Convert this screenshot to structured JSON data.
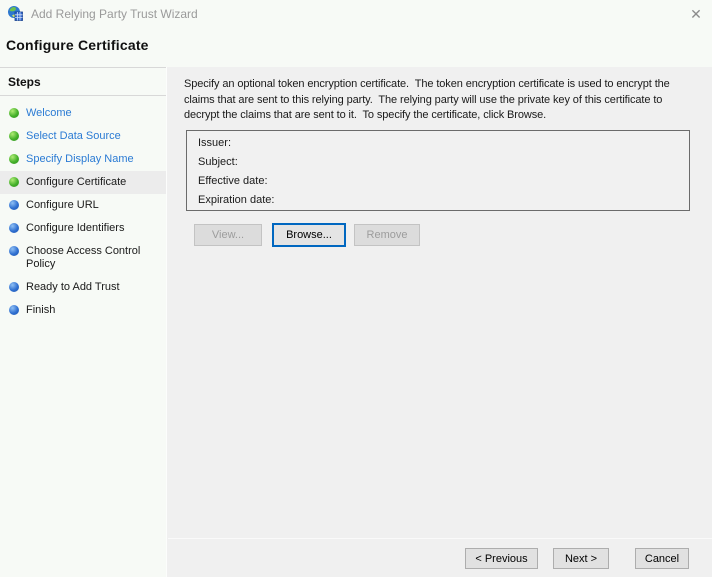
{
  "window": {
    "title": "Add Relying Party Trust Wizard"
  },
  "icons": {
    "close": "✕",
    "app": "adfs-wizard-icon"
  },
  "page": {
    "heading": "Configure Certificate"
  },
  "sidebar": {
    "header": "Steps",
    "items": [
      {
        "label": "Welcome",
        "state": "done"
      },
      {
        "label": "Select Data Source",
        "state": "done"
      },
      {
        "label": "Specify Display Name",
        "state": "done"
      },
      {
        "label": "Configure Certificate",
        "state": "current"
      },
      {
        "label": "Configure URL",
        "state": "todo"
      },
      {
        "label": "Configure Identifiers",
        "state": "todo"
      },
      {
        "label": "Choose Access Control Policy",
        "state": "todo"
      },
      {
        "label": "Ready to Add Trust",
        "state": "todo"
      },
      {
        "label": "Finish",
        "state": "todo"
      }
    ]
  },
  "main": {
    "description": "Specify an optional token encryption certificate.  The token encryption certificate is used to encrypt the claims that are sent to this relying party.  The relying party will use the private key of this certificate to decrypt the claims that are sent to it.  To specify the certificate, click Browse.",
    "certificate_panel": {
      "fields": [
        {
          "label": "Issuer:",
          "value": ""
        },
        {
          "label": "Subject:",
          "value": ""
        },
        {
          "label": "Effective date:",
          "value": ""
        },
        {
          "label": "Expiration date:",
          "value": ""
        }
      ]
    },
    "buttons": {
      "view": {
        "label": "View...",
        "enabled": false
      },
      "browse": {
        "label": "Browse...",
        "enabled": true,
        "default": true
      },
      "remove": {
        "label": "Remove",
        "enabled": false
      }
    }
  },
  "footer": {
    "previous": "< Previous",
    "next": "Next >",
    "cancel": "Cancel"
  },
  "colors": {
    "accent_blue": "#0067c0",
    "link_blue": "#2b7bd4",
    "step_done_bullet": "#44b02a",
    "step_todo_bullet": "#2f6fd0",
    "band_bg": "#f7faf6",
    "main_bg": "#f0f0f0",
    "highlight_row": "#ececec"
  }
}
